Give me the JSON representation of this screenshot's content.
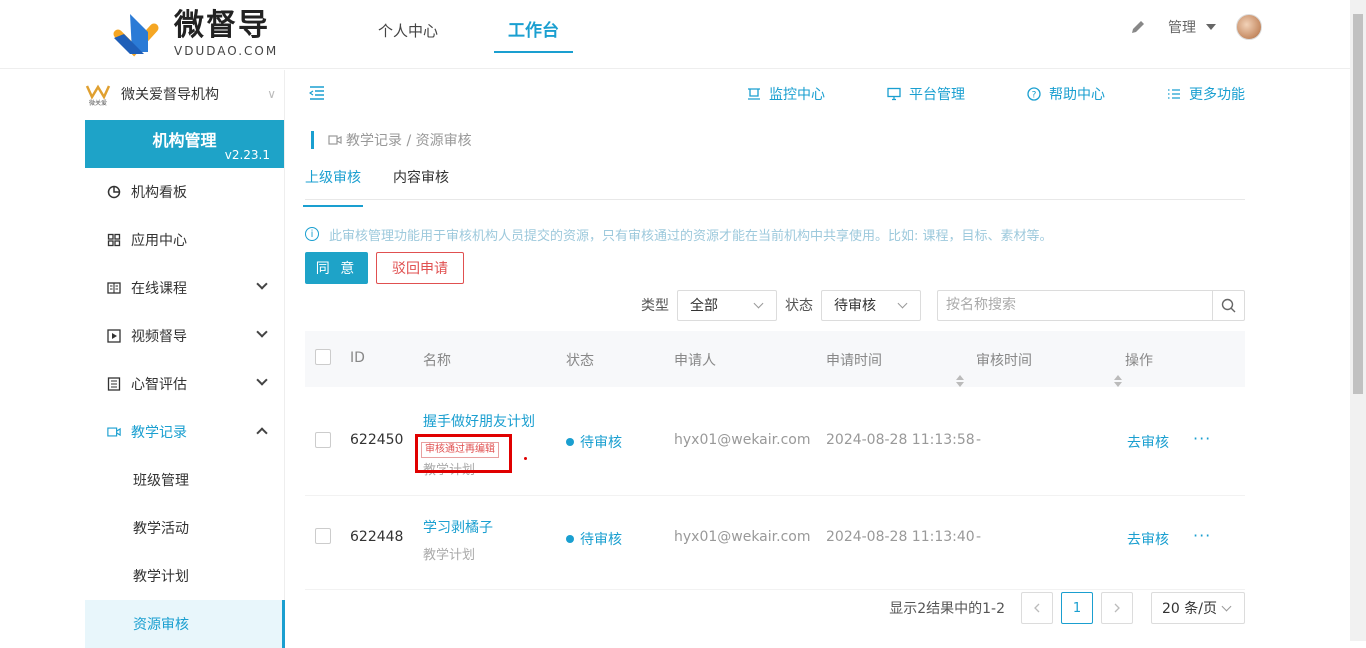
{
  "brand": {
    "name_cn": "微督导",
    "name_en": "VDUDAO.COM"
  },
  "topnav": {
    "tabs": [
      {
        "label": "个人中心"
      },
      {
        "label": "工作台"
      }
    ],
    "active": "工作台"
  },
  "user": {
    "name": "管理"
  },
  "sidebar": {
    "org": {
      "logo_text": "微关爱",
      "name": "微关爱督导机构"
    },
    "banner": {
      "title": "机构管理",
      "version": "v2.23.1"
    },
    "items": [
      {
        "label": "机构看板"
      },
      {
        "label": "应用中心"
      },
      {
        "label": "在线课程"
      },
      {
        "label": "视频督导"
      },
      {
        "label": "心智评估"
      },
      {
        "label": "教学记录"
      }
    ],
    "subitems": [
      {
        "label": "班级管理"
      },
      {
        "label": "教学活动"
      },
      {
        "label": "教学计划"
      },
      {
        "label": "资源审核"
      }
    ]
  },
  "toolbar": {
    "monitor": "监控中心",
    "platform": "平台管理",
    "help": "帮助中心",
    "more": "更多功能"
  },
  "breadcrumb": "教学记录 / 资源审核",
  "subtabs": [
    {
      "label": "上级审核"
    },
    {
      "label": "内容审核"
    }
  ],
  "notice": "此审核管理功能用于审核机构人员提交的资源，只有审核通过的资源才能在当前机构中共享使用。比如: 课程，目标、素材等。",
  "actions": {
    "approve": "同 意",
    "reject": "驳回申请"
  },
  "filters": {
    "type_label": "类型",
    "type_value": "全部",
    "status_label": "状态",
    "status_value": "待审核",
    "search_placeholder": "按名称搜索"
  },
  "table": {
    "headers": {
      "id": "ID",
      "name": "名称",
      "status": "状态",
      "applicant": "申请人",
      "apply_time": "申请时间",
      "review_time": "审核时间",
      "ops": "操作"
    },
    "rows": [
      {
        "id": "622450",
        "name": "握手做好朋友计划",
        "tag": "审核通过再编辑",
        "category": "教学计划",
        "status": "待审核",
        "applicant": "hyx01@wekair.com",
        "apply_time": "2024-08-28 11:13:58",
        "review_time": "-",
        "op": "去审核",
        "more": "···"
      },
      {
        "id": "622448",
        "name": "学习剥橘子",
        "tag": "",
        "category": "教学计划",
        "status": "待审核",
        "applicant": "hyx01@wekair.com",
        "apply_time": "2024-08-28 11:13:40",
        "review_time": "-",
        "op": "去审核",
        "more": "···"
      }
    ]
  },
  "pagination": {
    "summary": "显示2结果中的1-2",
    "current": "1",
    "page_size": "20 条/页"
  }
}
